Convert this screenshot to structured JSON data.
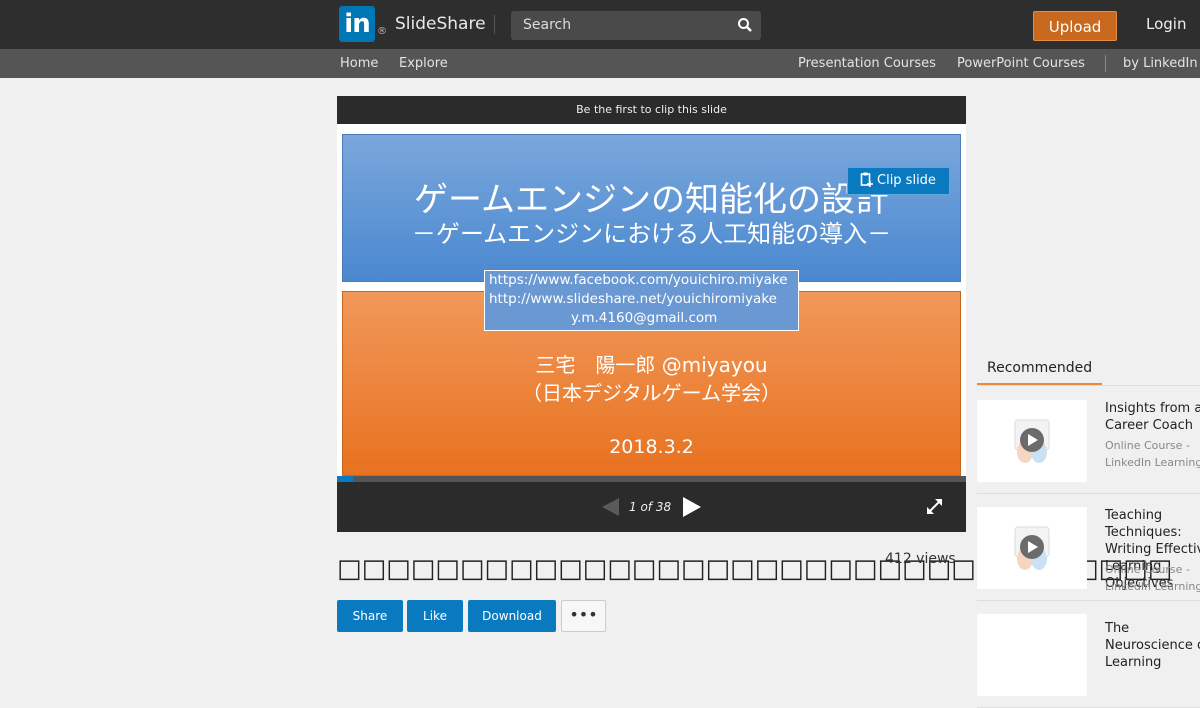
{
  "header": {
    "logo": "in",
    "brand": "SlideShare",
    "search_placeholder": "Search",
    "upload_label": "Upload",
    "login_label": "Login"
  },
  "subnav": {
    "left": [
      "Home",
      "Explore"
    ],
    "right": [
      "Presentation Courses",
      "PowerPoint Courses",
      "by LinkedIn Learning"
    ]
  },
  "player": {
    "clip_banner": "Be the first to clip this slide",
    "clip_button": "Clip slide",
    "counter": "1 of 38",
    "progress": 0.026,
    "slide": {
      "title": "ゲームエンジンの知能化の設計",
      "subtitle": "－ゲームエンジンにおける人工知能の導入－",
      "links": [
        "https://www.facebook.com/youichiro.miyake",
        "http://www.slideshare.net/youichiromiyake",
        "y.m.4160@gmail.com"
      ],
      "author": "三宅　陽一郎 @miyayou",
      "org": "（日本デジタルゲーム学会）",
      "date": "2018.3.2"
    }
  },
  "main": {
    "title": "□□□□□□□□□□□□□□□□□□□□□□□□□□□□□□□□□□",
    "views": "412 views",
    "buttons": [
      "Share",
      "Like",
      "Download"
    ],
    "more": "•••"
  },
  "sidebar": {
    "tab": "Recommended",
    "items": [
      {
        "title": "Insights from a Career Coach",
        "sub": "Online Course - LinkedIn Learning"
      },
      {
        "title": "Teaching Techniques: Writing Effective Learning Objectives",
        "sub": "Online Course - LinkedIn Learning"
      },
      {
        "title": "The Neuroscience of Learning",
        "sub": ""
      }
    ]
  },
  "colors": {
    "topbar": "#2e2e2e",
    "subnav": "#555555",
    "accent_blue": "#0a7ac0",
    "upload_orange": "#c8691f"
  }
}
